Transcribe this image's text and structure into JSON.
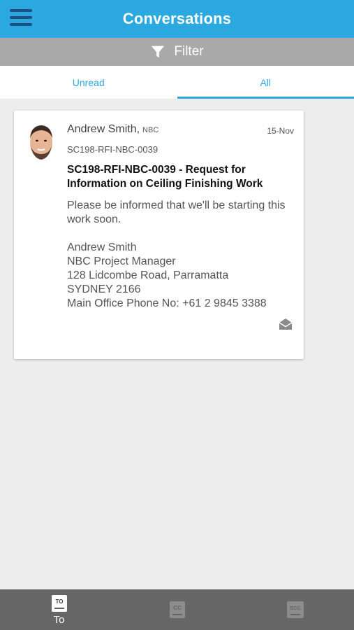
{
  "header": {
    "title": "Conversations",
    "menu_icon": "hamburger-menu-icon"
  },
  "filter": {
    "label": "Filter",
    "icon": "funnel-icon"
  },
  "tabs": [
    {
      "label": "Unread",
      "active": false
    },
    {
      "label": "All",
      "active": true
    }
  ],
  "conversation": {
    "sender_name": "Andrew Smith",
    "sender_org": "NBC",
    "date": "15-Nov",
    "reference": "SC198-RFI-NBC-0039",
    "subject": "SC198-RFI-NBC-0039 - Request for Information on Ceiling Finishing Work",
    "body_intro": "Please be informed that we'll be starting this work soon.",
    "signature": [
      "Andrew Smith",
      "NBC Project Manager",
      "128 Lidcombe Road, Parramatta",
      "SYDNEY 2166",
      "Main Office Phone No: +61 2 9845 3388"
    ],
    "status_icon": "envelope-open-icon"
  },
  "bottom_nav": [
    {
      "label": "To",
      "icon_text": "TO",
      "active": true
    },
    {
      "label": "",
      "icon_text": "CC",
      "active": false
    },
    {
      "label": "",
      "icon_text": "BCC",
      "active": false
    }
  ],
  "colors": {
    "primary": "#2aa8df",
    "menu_icon": "#1e4f80",
    "filter_bar": "#a9a9a9",
    "bottom_bar": "#666666"
  }
}
